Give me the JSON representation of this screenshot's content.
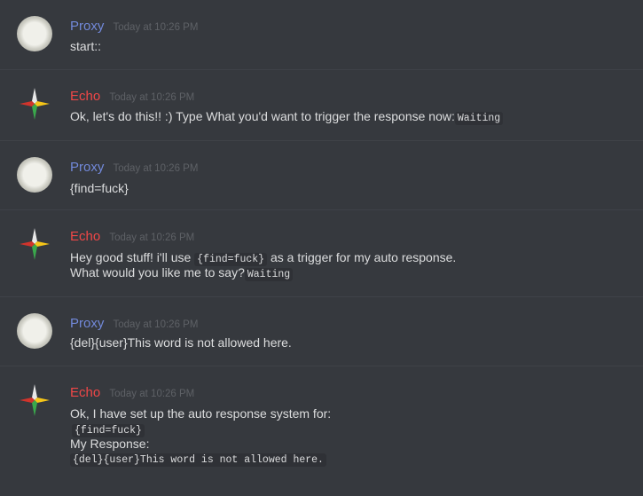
{
  "messages": [
    {
      "author": "Proxy",
      "timestamp": "Today at 10:26 PM",
      "text": "start::"
    },
    {
      "author": "Echo",
      "timestamp": "Today at 10:26 PM",
      "text": "Ok, let's do this!! :) Type What you'd want to trigger the response now:",
      "code": "Waiting"
    },
    {
      "author": "Proxy",
      "timestamp": "Today at 10:26 PM",
      "text": "{find=fuck}"
    },
    {
      "author": "Echo",
      "timestamp": "Today at 10:26 PM",
      "line1_pre": "Hey good stuff! i'll use ",
      "line1_code": "{find=fuck}",
      "line1_post": " as a trigger for my auto response.",
      "line2_text": "What would you like me to say?",
      "line2_code": "Waiting"
    },
    {
      "author": "Proxy",
      "timestamp": "Today at 10:26 PM",
      "text": "{del}{user}This word is not allowed here."
    },
    {
      "author": "Echo",
      "timestamp": "Today at 10:26 PM",
      "line1": "Ok, I have set up the auto response system for:",
      "code1": "{find=fuck}",
      "line3": "My Response:",
      "code2": "{del}{user}This word is not allowed here."
    }
  ]
}
